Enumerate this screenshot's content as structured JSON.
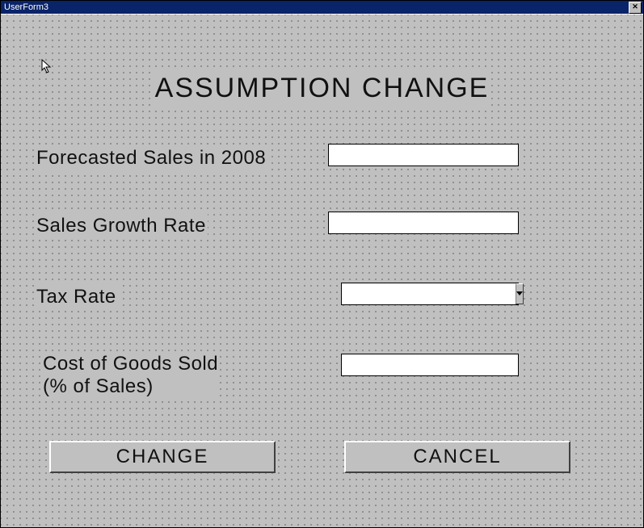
{
  "window": {
    "title": "UserForm3"
  },
  "form": {
    "heading": "ASSUMPTION CHANGE"
  },
  "fields": {
    "forecasted_sales": {
      "label": "Forecasted Sales in 2008",
      "value": ""
    },
    "sales_growth_rate": {
      "label": "Sales Growth Rate",
      "value": ""
    },
    "tax_rate": {
      "label": "Tax Rate",
      "value": ""
    },
    "cogs": {
      "label_line1": "Cost of Goods Sold",
      "label_line2": "(% of Sales)",
      "value": ""
    }
  },
  "buttons": {
    "change": "CHANGE",
    "cancel": "CANCEL"
  },
  "icons": {
    "close": "✕"
  }
}
